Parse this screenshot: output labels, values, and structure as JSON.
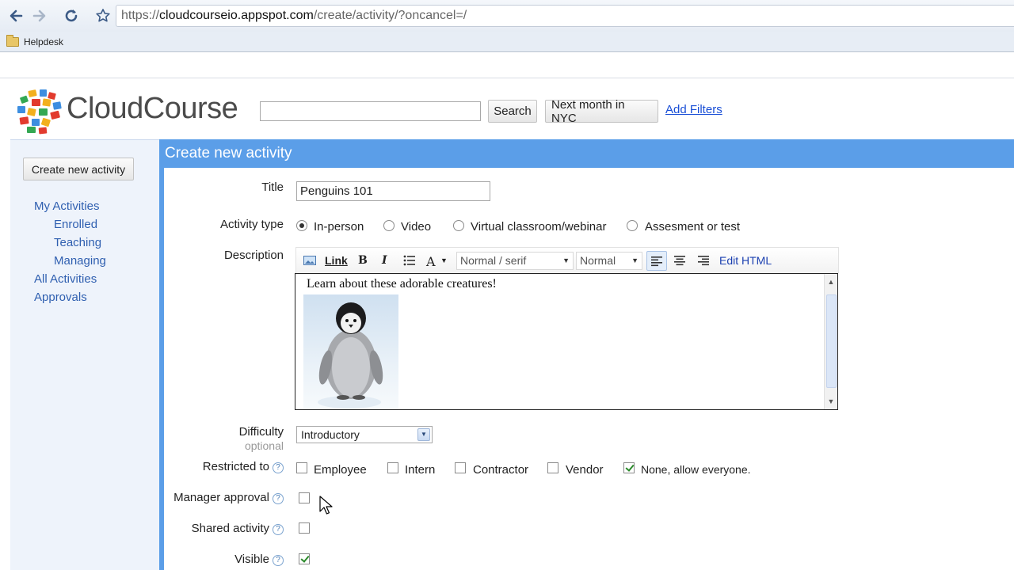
{
  "browser": {
    "url_prefix": "https://",
    "url_host": "cloudcourseio.appspot.com",
    "url_path": "/create/activity/?oncancel=/",
    "bookmark": "Helpdesk"
  },
  "header": {
    "brand": "CloudCourse",
    "search_button": "Search",
    "preset_button": "Next month in NYC",
    "add_filters": "Add Filters"
  },
  "sidebar": {
    "create_button": "Create new activity",
    "my_activities": "My Activities",
    "enrolled": "Enrolled",
    "teaching": "Teaching",
    "managing": "Managing",
    "all_activities": "All Activities",
    "approvals": "Approvals"
  },
  "form": {
    "heading": "Create new activity",
    "title_label": "Title",
    "title_value": "Penguins 101",
    "activity_type_label": "Activity type",
    "activity_types": [
      "In-person",
      "Video",
      "Virtual classroom/webinar",
      "Assesment or test"
    ],
    "activity_type_selected": "In-person",
    "description_label": "Description",
    "editor": {
      "link": "Link",
      "bold": "B",
      "italic": "I",
      "font_color": "A",
      "font_family": "Normal / serif",
      "font_size": "Normal",
      "edit_html": "Edit HTML",
      "content_text": "Learn about these adorable creatures!",
      "image_subject": "penguin chick"
    },
    "difficulty_label": "Difficulty",
    "difficulty_sub": "optional",
    "difficulty_value": "Introductory",
    "restricted_label": "Restricted to",
    "restricted_options": [
      "Employee",
      "Intern",
      "Contractor",
      "Vendor",
      "None, allow everyone."
    ],
    "restricted_checked": "None, allow everyone.",
    "manager_approval_label": "Manager approval",
    "manager_approval_checked": false,
    "shared_activity_label": "Shared activity",
    "shared_activity_checked": false,
    "visible_label": "Visible",
    "visible_checked": true,
    "help_glyph": "?"
  },
  "colors": {
    "panel_accent": "#5b9ee8",
    "link": "#1a4fd6",
    "sidebar_bg": "#eef3fb"
  }
}
